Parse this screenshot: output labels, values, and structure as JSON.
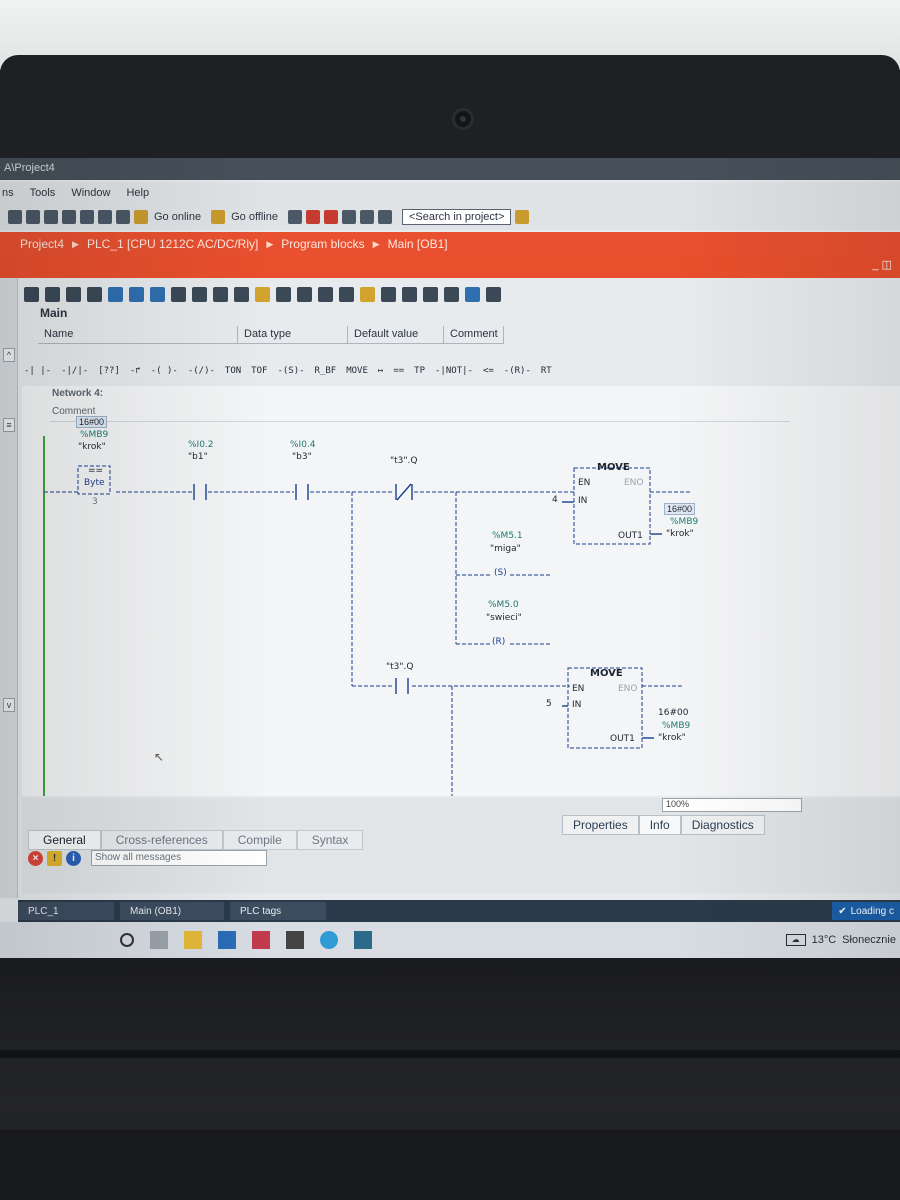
{
  "window": {
    "title": "A\\Project4"
  },
  "menu": {
    "items": [
      "ns",
      "Tools",
      "Window",
      "Help"
    ]
  },
  "toolbar": {
    "go_online": "Go online",
    "go_offline": "Go offline",
    "search_placeholder": "<Search in project>"
  },
  "breadcrumb": {
    "items": [
      "Project4",
      "PLC_1 [CPU 1212C AC/DC/Rly]",
      "Program blocks",
      "Main [OB1]"
    ]
  },
  "block": {
    "name": "Main",
    "columns": [
      "Name",
      "Data type",
      "Default value",
      "Comment"
    ]
  },
  "instructions": [
    "TON",
    "TOF",
    "MOVE",
    "TP"
  ],
  "network": {
    "label": "Network 4:",
    "comment_label": "Comment"
  },
  "ladder": {
    "cmp": {
      "value": "16#00",
      "address": "%MB9",
      "tag": "\"krok\"",
      "op": "==",
      "type": "Byte",
      "operand2": "3"
    },
    "contact1": {
      "address": "%I0.2",
      "tag": "\"b1\""
    },
    "contact2": {
      "address": "%I0.4",
      "tag": "\"b3\""
    },
    "contact3": {
      "tag": "\"t3\".Q"
    },
    "contact4": {
      "tag": "\"t3\".Q"
    },
    "coil_set": {
      "address": "%M5.1",
      "tag": "\"miga\"",
      "type": "S"
    },
    "coil_reset": {
      "address": "%M5.0",
      "tag": "\"swieci\"",
      "type": "R"
    },
    "move1": {
      "title": "MOVE",
      "en": "EN",
      "eno": "ENO",
      "in": "IN",
      "in_value": "4",
      "out": "OUT1",
      "out_value": "16#00",
      "out_address": "%MB9",
      "out_tag": "\"krok\""
    },
    "move2": {
      "title": "MOVE",
      "en": "EN",
      "eno": "ENO",
      "in": "IN",
      "in_value": "5",
      "out": "OUT1",
      "out_value": "16#00",
      "out_address": "%MB9",
      "out_tag": "\"krok\""
    }
  },
  "zoom": "100%",
  "inspector_tabs": [
    "Properties",
    "Info",
    "Diagnostics"
  ],
  "bottom_tabs": [
    "General",
    "Cross-references",
    "Compile",
    "Syntax"
  ],
  "messages_filter": "Show all messages",
  "portal_tabs": [
    "PLC_1",
    "Main (OB1)",
    "PLC tags"
  ],
  "loading": "Loading c",
  "weather": {
    "temp": "13°C",
    "desc": "Słonecznie"
  },
  "colors": {
    "breadcrumb": "#e8502f",
    "wire": "#1c3f8f",
    "address": "#1b7a70"
  }
}
